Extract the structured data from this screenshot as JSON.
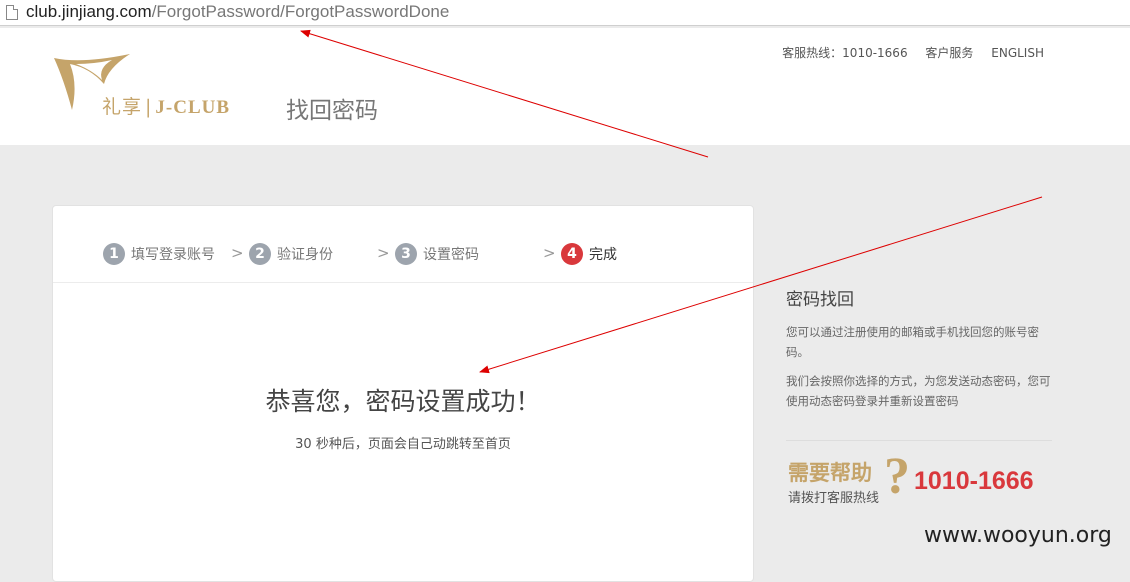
{
  "browser": {
    "url_host": "club.jinjiang.com",
    "url_path": "/ForgotPassword/ForgotPasswordDone"
  },
  "header": {
    "hotline": "客服热线：1010-1666",
    "customer_service": "客户服务",
    "language": "ENGLISH",
    "logo_cn": "礼享",
    "logo_sep": "|",
    "logo_en": "J-CLUB",
    "page_title": "找回密码"
  },
  "steps": [
    {
      "num": "1",
      "label": "填写登录账号",
      "active": false
    },
    {
      "num": "2",
      "label": "验证身份",
      "active": false
    },
    {
      "num": "3",
      "label": "设置密码",
      "active": false
    },
    {
      "num": "4",
      "label": "完成",
      "active": true
    }
  ],
  "step_separator": ">",
  "main": {
    "success_title": "恭喜您，密码设置成功！",
    "success_sub": "30 秒种后，页面会自己动跳转至首页"
  },
  "sidebar": {
    "title": "密码找回",
    "p1": "您可以通过注册使用的邮箱或手机找回您的账号密码。",
    "p2": "我们会按照你选择的方式，为您发送动态密码，您可使用动态密码登录并重新设置密码",
    "help_big": "需要帮助",
    "help_q": "?",
    "help_small": "请拨打客服热线",
    "help_phone": "1010-1666"
  },
  "watermark": "www.wooyun.org",
  "colors": {
    "accent_gold": "#c5a46a",
    "accent_red": "#d9383c",
    "annotation_arrow": "#dd0000"
  }
}
